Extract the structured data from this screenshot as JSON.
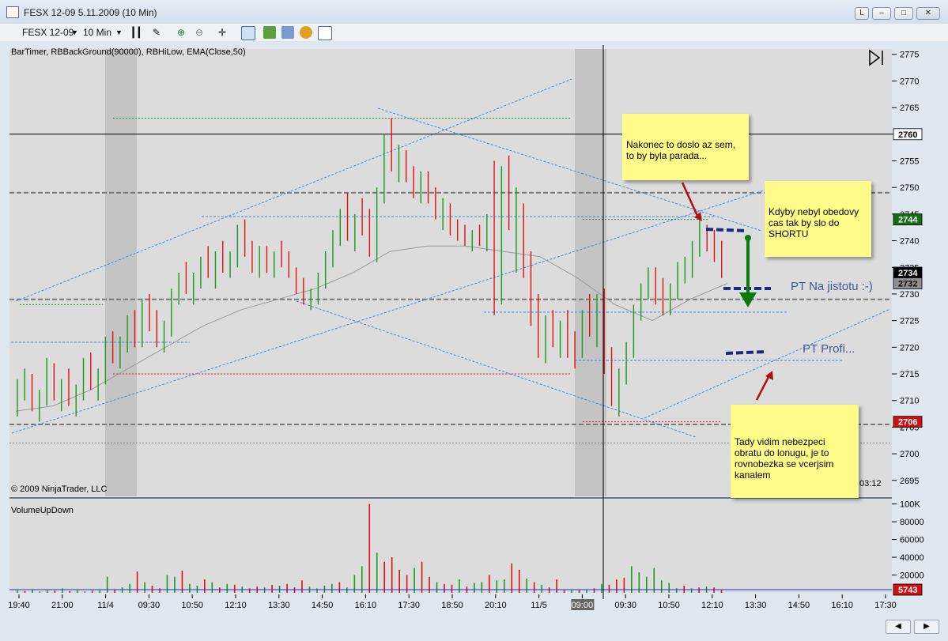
{
  "window": {
    "title": "FESX 12-09  5.11.2009 (10 Min)",
    "btn_l": "L"
  },
  "toolbar": {
    "instrument": "FESX 12-09",
    "interval": "10 Min"
  },
  "chart_data": [
    {
      "type": "candlestick",
      "indicators_label": "BarTimer, RBBackGround(90000), RBHiLow, EMA(Close,50)",
      "copyright": "© 2009 NinjaTrader, LLC",
      "bar_timer": "03:12",
      "ylim": [
        2692,
        2776
      ],
      "y_ticks": [
        2695,
        2700,
        2705,
        2710,
        2715,
        2720,
        2725,
        2730,
        2735,
        2740,
        2745,
        2750,
        2755,
        2760,
        2765,
        2770,
        2775
      ],
      "x_ticks": [
        "19:40",
        "21:00",
        "11/4",
        "09:30",
        "10:50",
        "12:10",
        "13:30",
        "14:50",
        "16:10",
        "17:30",
        "18:50",
        "20:10",
        "11/5",
        "09:00",
        "09:30",
        "10:50",
        "12:10",
        "13:30",
        "14:50",
        "16:10",
        "17:30"
      ],
      "price_marks": [
        {
          "value": 2760,
          "color": "#ffffff",
          "text": "#000000"
        },
        {
          "value": 2744,
          "color": "#107010",
          "text": "#ffffff"
        },
        {
          "value": 2734,
          "color": "#000000",
          "text": "#ffffff"
        },
        {
          "value": 2732,
          "color": "#909090",
          "text": "#000000"
        },
        {
          "value": 2706,
          "color": "#d01010",
          "text": "#ffffff"
        }
      ],
      "candles": [
        [
          2710,
          2714,
          2707,
          2712
        ],
        [
          2712,
          2716,
          2710,
          2714
        ],
        [
          2714,
          2715,
          2708,
          2709
        ],
        [
          2709,
          2712,
          2706,
          2711
        ],
        [
          2711,
          2718,
          2709,
          2716
        ],
        [
          2716,
          2717,
          2710,
          2711
        ],
        [
          2711,
          2714,
          2708,
          2713
        ],
        [
          2713,
          2716,
          2709,
          2710
        ],
        [
          2710,
          2713,
          2707,
          2712
        ],
        [
          2712,
          2718,
          2710,
          2717
        ],
        [
          2717,
          2719,
          2712,
          2713
        ],
        [
          2713,
          2716,
          2710,
          2715
        ],
        [
          2715,
          2722,
          2713,
          2721
        ],
        [
          2721,
          2723,
          2717,
          2718
        ],
        [
          2718,
          2722,
          2716,
          2721
        ],
        [
          2721,
          2726,
          2719,
          2725
        ],
        [
          2725,
          2727,
          2720,
          2722
        ],
        [
          2722,
          2729,
          2720,
          2728
        ],
        [
          2728,
          2730,
          2723,
          2724
        ],
        [
          2724,
          2727,
          2720,
          2722
        ],
        [
          2722,
          2725,
          2719,
          2724
        ],
        [
          2724,
          2731,
          2722,
          2730
        ],
        [
          2730,
          2734,
          2728,
          2733
        ],
        [
          2733,
          2736,
          2730,
          2731
        ],
        [
          2731,
          2734,
          2728,
          2733
        ],
        [
          2733,
          2737,
          2731,
          2736
        ],
        [
          2736,
          2739,
          2733,
          2734
        ],
        [
          2734,
          2738,
          2731,
          2737
        ],
        [
          2737,
          2740,
          2734,
          2735
        ],
        [
          2735,
          2738,
          2733,
          2737
        ],
        [
          2737,
          2743,
          2735,
          2741
        ],
        [
          2741,
          2744,
          2737,
          2738
        ],
        [
          2738,
          2740,
          2734,
          2736
        ],
        [
          2736,
          2739,
          2733,
          2737
        ],
        [
          2737,
          2739,
          2734,
          2735
        ],
        [
          2735,
          2738,
          2733,
          2737
        ],
        [
          2737,
          2740,
          2735,
          2736
        ],
        [
          2736,
          2738,
          2733,
          2734
        ],
        [
          2734,
          2735,
          2730,
          2731
        ],
        [
          2731,
          2733,
          2728,
          2729
        ],
        [
          2729,
          2731,
          2727,
          2730
        ],
        [
          2730,
          2734,
          2728,
          2733
        ],
        [
          2733,
          2738,
          2731,
          2737
        ],
        [
          2737,
          2742,
          2735,
          2741
        ],
        [
          2741,
          2746,
          2739,
          2745
        ],
        [
          2745,
          2749,
          2740,
          2741
        ],
        [
          2741,
          2745,
          2738,
          2744
        ],
        [
          2744,
          2748,
          2741,
          2742
        ],
        [
          2742,
          2746,
          2737,
          2738
        ],
        [
          2738,
          2750,
          2736,
          2749
        ],
        [
          2749,
          2760,
          2747,
          2759
        ],
        [
          2759,
          2763,
          2753,
          2755
        ],
        [
          2755,
          2758,
          2751,
          2756
        ],
        [
          2756,
          2757,
          2751,
          2752
        ],
        [
          2752,
          2754,
          2748,
          2750
        ],
        [
          2750,
          2753,
          2747,
          2751
        ],
        [
          2751,
          2753,
          2747,
          2748
        ],
        [
          2748,
          2750,
          2744,
          2745
        ],
        [
          2745,
          2748,
          2742,
          2746
        ],
        [
          2746,
          2747,
          2741,
          2742
        ],
        [
          2742,
          2744,
          2740,
          2741
        ],
        [
          2741,
          2743,
          2739,
          2740
        ],
        [
          2740,
          2742,
          2738,
          2741
        ],
        [
          2741,
          2743,
          2739,
          2740
        ],
        [
          2740,
          2745,
          2738,
          2744
        ],
        [
          2744,
          2755,
          2726,
          2740
        ],
        [
          2740,
          2754,
          2728,
          2752
        ],
        [
          2752,
          2756,
          2742,
          2743
        ],
        [
          2743,
          2750,
          2734,
          2744
        ],
        [
          2744,
          2747,
          2733,
          2735
        ],
        [
          2735,
          2738,
          2724,
          2727
        ],
        [
          2727,
          2730,
          2718,
          2721
        ],
        [
          2721,
          2726,
          2717,
          2725
        ],
        [
          2725,
          2727,
          2720,
          2721
        ],
        [
          2721,
          2725,
          2718,
          2724
        ],
        [
          2724,
          2727,
          2718,
          2720
        ],
        [
          2720,
          2723,
          2716,
          2719
        ],
        [
          2719,
          2727,
          2718,
          2726
        ],
        [
          2726,
          2730,
          2722,
          2723
        ],
        [
          2723,
          2730,
          2720,
          2729
        ],
        [
          2729,
          2731,
          2715,
          2718
        ],
        [
          2718,
          2720,
          2709,
          2711
        ],
        [
          2711,
          2716,
          2707,
          2715
        ],
        [
          2715,
          2721,
          2713,
          2720
        ],
        [
          2720,
          2728,
          2718,
          2727
        ],
        [
          2727,
          2732,
          2725,
          2731
        ],
        [
          2731,
          2735,
          2729,
          2733
        ],
        [
          2733,
          2735,
          2728,
          2730
        ],
        [
          2730,
          2733,
          2726,
          2727
        ],
        [
          2727,
          2732,
          2726,
          2731
        ],
        [
          2731,
          2736,
          2729,
          2734
        ],
        [
          2734,
          2737,
          2732,
          2735
        ],
        [
          2735,
          2740,
          2733,
          2739
        ],
        [
          2739,
          2744,
          2737,
          2742
        ],
        [
          2742,
          2743,
          2738,
          2740
        ],
        [
          2740,
          2742,
          2736,
          2738
        ],
        [
          2738,
          2740,
          2733,
          2734
        ]
      ],
      "ema": [
        2708,
        2709,
        2712,
        2716,
        2720,
        2724,
        2727,
        2729,
        2731,
        2734,
        2738,
        2739,
        2739,
        2738,
        2737,
        2733,
        2728,
        2725,
        2729,
        2732
      ],
      "annotations": [
        {
          "text": "PT Na jistotu :-)",
          "color": "#3a5a9a"
        },
        {
          "text": "PT Profi...",
          "color": "#3a5a9a"
        }
      ],
      "notes": [
        {
          "text": "Nakonec to doslo az sem, to by byla parada..."
        },
        {
          "text": "Kdyby nebyl obedovy cas tak by slo do SHORTU"
        },
        {
          "text": "Tady vidim nebezpeci obratu do lonugu, je to rovnobezka se vcerjsim kanalem"
        }
      ]
    },
    {
      "type": "bar",
      "label": "VolumeUpDown",
      "ylim": [
        0,
        105000
      ],
      "y_ticks": [
        "100K",
        "80000",
        "60000",
        "40000",
        "20000"
      ],
      "last_value": "5743",
      "last_color": "#d01010",
      "values": [
        3000,
        2000,
        4000,
        1500,
        3000,
        2500,
        5000,
        2000,
        3000,
        1500,
        2500,
        3000,
        18000,
        4000,
        6000,
        10000,
        24000,
        12000,
        8000,
        5000,
        20000,
        18000,
        25000,
        10000,
        8000,
        15000,
        12000,
        6000,
        10000,
        9000,
        7000,
        5000,
        7000,
        6000,
        9000,
        8000,
        10000,
        6000,
        14000,
        7000,
        5000,
        8000,
        10000,
        12000,
        6000,
        20000,
        30000,
        100000,
        45000,
        35000,
        40000,
        26000,
        20000,
        28000,
        35000,
        18000,
        12000,
        10000,
        9000,
        15000,
        7000,
        11000,
        12000,
        20000,
        14000,
        15000,
        33000,
        26000,
        16000,
        12000,
        9000,
        6000,
        15000,
        3000,
        4000,
        3500,
        4000,
        5000,
        10000,
        9000,
        15000,
        17000,
        30000,
        23000,
        18000,
        28000,
        14000,
        11000,
        5000,
        8000,
        5000,
        6000,
        7000,
        6000,
        3000
      ],
      "directions": "GRGGGRGRGGRGGRGGRGRRGGRGGRGRGRGRRGRGRRRGGGGRGGGRGRRRRGRRGRRGRGGRGGRRGRGRRRGRGRGRRRGGGGGGGRGRG"
    }
  ]
}
